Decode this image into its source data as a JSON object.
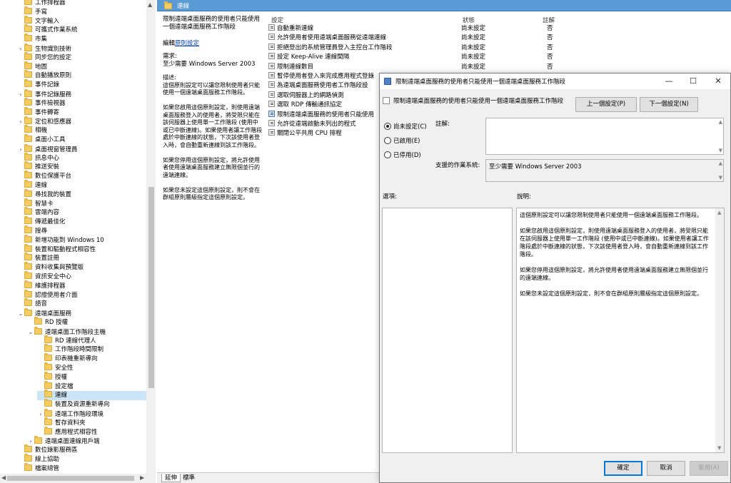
{
  "tree": {
    "items": [
      {
        "label": "工作排程器",
        "level": 1,
        "chev": ""
      },
      {
        "label": "手寫",
        "level": 1,
        "chev": ""
      },
      {
        "label": "文字輸入",
        "level": 1,
        "chev": ""
      },
      {
        "label": "可攜式作業系統",
        "level": 1,
        "chev": ""
      },
      {
        "label": "市集",
        "level": 1,
        "chev": ""
      },
      {
        "label": "生物識別技術",
        "level": 1,
        "chev": "›"
      },
      {
        "label": "同步您的設定",
        "level": 1,
        "chev": ""
      },
      {
        "label": "地圖",
        "level": 1,
        "chev": ""
      },
      {
        "label": "自動播放原則",
        "level": 1,
        "chev": ""
      },
      {
        "label": "事件記錄",
        "level": 1,
        "chev": ""
      },
      {
        "label": "事件記錄服務",
        "level": 1,
        "chev": "›"
      },
      {
        "label": "事件檢視器",
        "level": 1,
        "chev": ""
      },
      {
        "label": "事件轉寄",
        "level": 1,
        "chev": ""
      },
      {
        "label": "定位和感應器",
        "level": 1,
        "chev": "›"
      },
      {
        "label": "相機",
        "level": 1,
        "chev": ""
      },
      {
        "label": "桌面小工具",
        "level": 1,
        "chev": ""
      },
      {
        "label": "桌面視窗管理員",
        "level": 1,
        "chev": "›"
      },
      {
        "label": "訊息中心",
        "level": 1,
        "chev": ""
      },
      {
        "label": "推送安裝",
        "level": 1,
        "chev": ""
      },
      {
        "label": "數位保護平台",
        "level": 1,
        "chev": ""
      },
      {
        "label": "連線",
        "level": 1,
        "chev": ""
      },
      {
        "label": "尋找我的裝置",
        "level": 1,
        "chev": ""
      },
      {
        "label": "智慧卡",
        "level": 1,
        "chev": ""
      },
      {
        "label": "雲端內容",
        "level": 1,
        "chev": ""
      },
      {
        "label": "傳遞最佳化",
        "level": 1,
        "chev": ""
      },
      {
        "label": "搜尋",
        "level": 1,
        "chev": ""
      },
      {
        "label": "新增功能到 Windows 10",
        "level": 1,
        "chev": ""
      },
      {
        "label": "裝置和驅動程式相容性",
        "level": 1,
        "chev": ""
      },
      {
        "label": "裝置註冊",
        "level": 1,
        "chev": ""
      },
      {
        "label": "資料收集與預覽版",
        "level": 1,
        "chev": ""
      },
      {
        "label": "資訊安全中心",
        "level": 1,
        "chev": ""
      },
      {
        "label": "維護排程器",
        "level": 1,
        "chev": ""
      },
      {
        "label": "認證使用者介面",
        "level": 1,
        "chev": ""
      },
      {
        "label": "語音",
        "level": 1,
        "chev": ""
      },
      {
        "label": "遠端桌面服務",
        "level": 1,
        "chev": "⌄"
      },
      {
        "label": "RD 授權",
        "level": 2,
        "chev": ""
      },
      {
        "label": "遠端桌面工作階段主機",
        "level": 2,
        "chev": "⌄"
      },
      {
        "label": "RD 連線代理人",
        "level": 3,
        "chev": ""
      },
      {
        "label": "工作階段時間限制",
        "level": 3,
        "chev": ""
      },
      {
        "label": "印表機重新導向",
        "level": 3,
        "chev": ""
      },
      {
        "label": "安全性",
        "level": 3,
        "chev": ""
      },
      {
        "label": "授權",
        "level": 3,
        "chev": ""
      },
      {
        "label": "設定檔",
        "level": 3,
        "chev": ""
      },
      {
        "label": "連線",
        "level": 3,
        "chev": "",
        "selected": true
      },
      {
        "label": "裝置及資源重新導向",
        "level": 3,
        "chev": ""
      },
      {
        "label": "遠端工作階段環境",
        "level": 3,
        "chev": "›"
      },
      {
        "label": "暫存資料夾",
        "level": 3,
        "chev": ""
      },
      {
        "label": "應用程式相容性",
        "level": 3,
        "chev": ""
      },
      {
        "label": "遠端桌面連線用戶端",
        "level": 2,
        "chev": "›"
      },
      {
        "label": "數位錄影服務區",
        "level": 1,
        "chev": ""
      },
      {
        "label": "線上協助",
        "level": 1,
        "chev": ""
      },
      {
        "label": "檔案總管",
        "level": 1,
        "chev": ""
      }
    ]
  },
  "main": {
    "header_title": "連線",
    "desc": {
      "heading": "限制遠端桌面服務的使用者只能使用一個遠端桌面服務工作階段",
      "edit_prefix": "編輯",
      "edit_link": "原則設定",
      "requirement_label": "需求:",
      "requirement_value": "至少需要 Windows Server 2003",
      "body": "描述:\n這個原則設定可以讓您限制使用者只能使用一個遠端桌面服務工作階段。\n\n如果您啟用這個原則設定，則使用遠端桌面服務登入的使用者，將受限只能在該伺服器上使用單一工作階段 (使用中或已中斷連線)。如果使用者讓工作階段處於中斷連線的狀態，下次該使用者登入時，會自動重新連線到該工作階段。\n\n如果您停用這個原則設定，將允許使用者使用遠端桌面服務建立無限個並行的遠端連線。\n\n如果您未設定這個原則設定，則不會在群組原則層級指定這個原則設定。"
    },
    "columns": {
      "setting": "設定",
      "state": "狀態",
      "note": "註解"
    },
    "settings": [
      {
        "name": "自動重新連線",
        "state": "尚未設定",
        "note": "否"
      },
      {
        "name": "允許使用者使用遠端桌面服務從遠端連線",
        "state": "尚未設定",
        "note": "否"
      },
      {
        "name": "拒絕登出的系統管理員登入主控台工作階段",
        "state": "尚未設定",
        "note": "否"
      },
      {
        "name": "設定 Keep-Alive 連線間隔",
        "state": "尚未設定",
        "note": "否"
      },
      {
        "name": "限制連線數目",
        "state": "尚未設定",
        "note": "否"
      },
      {
        "name": "暫停使用者登入來完成應用程式登錄",
        "state": "",
        "note": ""
      },
      {
        "name": "為遠端桌面服務使用者工作階段設",
        "state": "",
        "note": ""
      },
      {
        "name": "選取伺服器上的網路偵測",
        "state": "",
        "note": ""
      },
      {
        "name": "選取 RDP 傳輸通訊協定",
        "state": "",
        "note": ""
      },
      {
        "name": "限制遠端桌面服務的使用者只能使用",
        "state": "",
        "note": "",
        "highlight": true
      },
      {
        "name": "允許從遠端啟動未列出的程式",
        "state": "",
        "note": ""
      },
      {
        "name": "關閉公平共用 CPU 排程",
        "state": "",
        "note": ""
      }
    ],
    "tabs": [
      "延伸",
      "標準"
    ]
  },
  "dialog": {
    "title": "限制遠端桌面服務的使用者只能使用一個遠端桌面服務工作階段",
    "setting_name": "限制遠端桌面服務的使用者只能使用一個遠端桌面服務工作階段",
    "prev_button": "上一個設定(P)",
    "next_button": "下一個設定(N)",
    "radio_not_configured": "尚未設定(C)",
    "radio_enabled": "已啟用(E)",
    "radio_disabled": "已停用(D)",
    "comment_label": "註解:",
    "supported_label": "支援的作業系統:",
    "supported_value": "至少需要 Windows Server 2003",
    "options_label": "選項:",
    "help_label": "說明:",
    "help_text": "這個原則設定可以讓您限制使用者只能使用一個遠端桌面服務工作階段。\n\n如果您啟用這個原則設定，則使用遠端桌面服務登入的使用者，將受限只能在該伺服器上使用單一工作階段 (使用中或已中斷連線)。如果使用者讓工作階段處於中斷連線的狀態，下次該使用者登入時，會自動重新連線到該工作階段。\n\n如果您停用這個原則設定，將允許使用者使用遠端桌面服務建立無限個並行的遠端連線。\n\n如果您未設定這個原則設定，則不會在群組原則層級指定這個原則設定。",
    "ok_button": "確定",
    "cancel_button": "取消",
    "apply_button": "套用(A)",
    "minimize": "—",
    "maximize": "☐",
    "close": "✕"
  }
}
